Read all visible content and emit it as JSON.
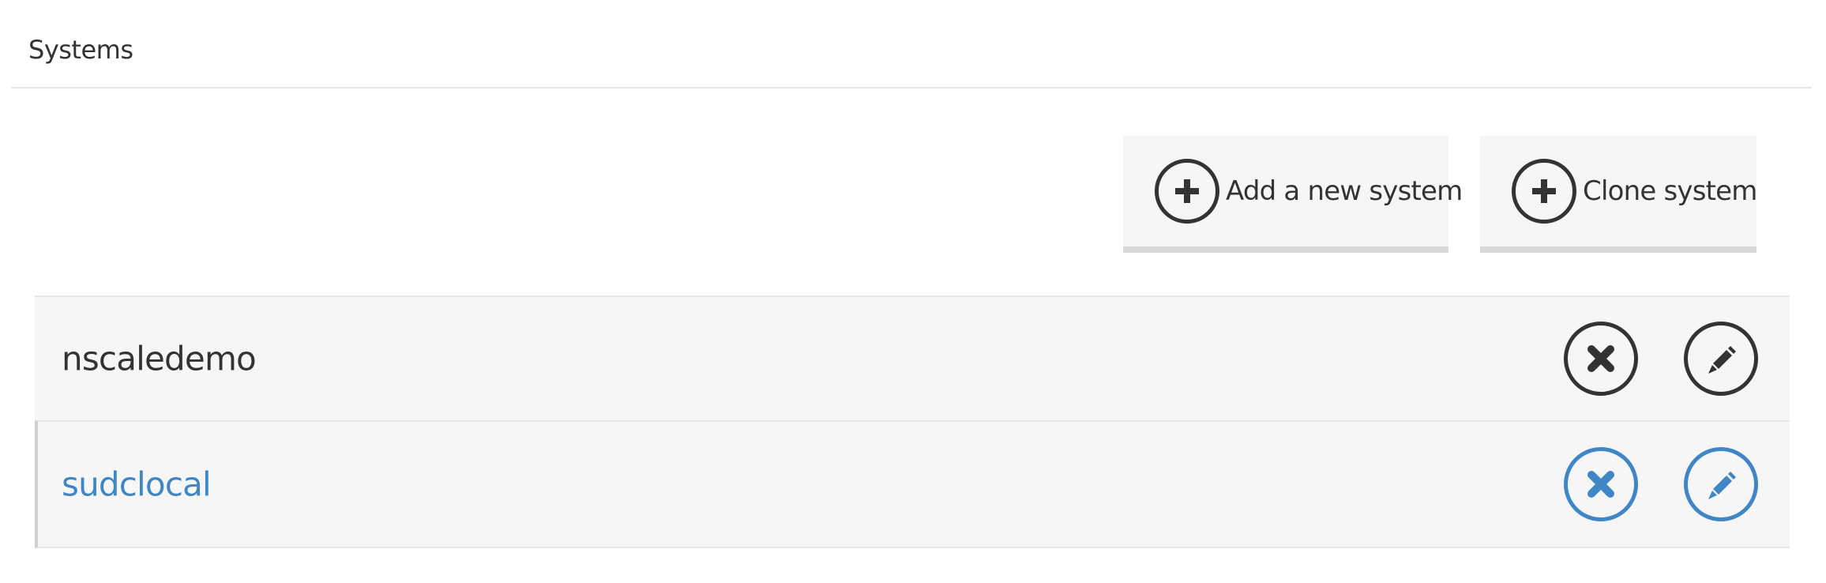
{
  "header": {
    "title": "Systems"
  },
  "actions": {
    "add_label": "Add a new system",
    "add_icon": "plus-circle-icon",
    "clone_label": "Clone system",
    "clone_icon": "plus-circle-icon"
  },
  "systems": [
    {
      "name": "nscaledemo",
      "selected": false,
      "color": "#333333",
      "delete_icon": "close-circle-icon",
      "edit_icon": "pencil-circle-icon"
    },
    {
      "name": "sudclocal",
      "selected": true,
      "color": "#3f86c7",
      "delete_icon": "close-circle-icon",
      "edit_icon": "pencil-circle-icon"
    }
  ],
  "colors": {
    "text": "#333333",
    "accent": "#3f86c7",
    "panel": "#f6f6f6",
    "divider": "#e6e6e6",
    "button_underline": "#d7d7d7"
  }
}
